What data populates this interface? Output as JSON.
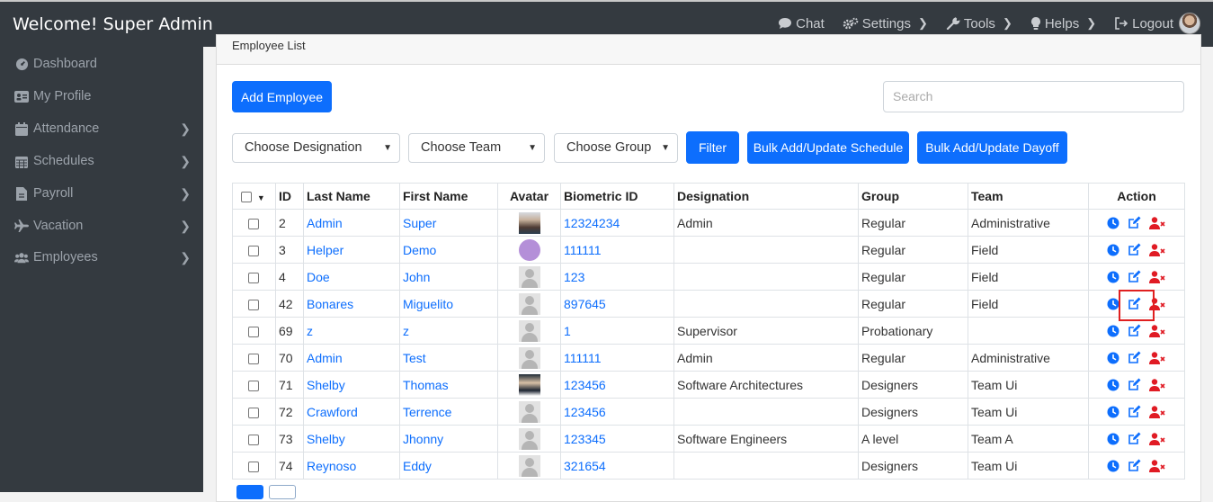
{
  "header": {
    "brand": "Welcome! Super Admin",
    "nav": [
      {
        "label": "Chat",
        "icon": "chat-icon"
      },
      {
        "label": "Settings",
        "icon": "gear-icon"
      },
      {
        "label": "Tools",
        "icon": "wrench-icon"
      },
      {
        "label": "Helps",
        "icon": "lightbulb-icon"
      },
      {
        "label": "Logout",
        "icon": "logout-icon"
      }
    ]
  },
  "sidebar": {
    "items": [
      {
        "label": "Dashboard",
        "icon": "dashboard-icon",
        "has_children": false
      },
      {
        "label": "My Profile",
        "icon": "id-card-icon",
        "has_children": false
      },
      {
        "label": "Attendance",
        "icon": "calendar-icon",
        "has_children": true
      },
      {
        "label": "Schedules",
        "icon": "calendar-grid-icon",
        "has_children": true
      },
      {
        "label": "Payroll",
        "icon": "file-icon",
        "has_children": true
      },
      {
        "label": "Vacation",
        "icon": "plane-icon",
        "has_children": true
      },
      {
        "label": "Employees",
        "icon": "users-icon",
        "has_children": true
      }
    ]
  },
  "card": {
    "title": "Employee List"
  },
  "toolbar": {
    "add_employee": "Add Employee",
    "search_placeholder": "Search",
    "designation_select": "Choose Designation",
    "team_select": "Choose Team",
    "group_select": "Choose Group",
    "filter": "Filter",
    "bulk_schedule": "Bulk Add/Update Schedule",
    "bulk_dayoff": "Bulk Add/Update Dayoff"
  },
  "table": {
    "headers": [
      "ID",
      "Last Name",
      "First Name",
      "Avatar",
      "Biometric ID",
      "Designation",
      "Group",
      "Team",
      "Action"
    ],
    "rows": [
      {
        "id": "2",
        "last": "Admin",
        "first": "Super",
        "avatar": "photo1",
        "bio": "12324234",
        "designation": "Admin",
        "group": "Regular",
        "team": "Administrative"
      },
      {
        "id": "3",
        "last": "Helper",
        "first": "Demo",
        "avatar": "photo2",
        "bio": "111111",
        "designation": "",
        "group": "Regular",
        "team": "Field"
      },
      {
        "id": "4",
        "last": "Doe",
        "first": "John",
        "avatar": "generic",
        "bio": "123",
        "designation": "",
        "group": "Regular",
        "team": "Field"
      },
      {
        "id": "42",
        "last": "Bonares",
        "first": "Miguelito",
        "avatar": "generic",
        "bio": "897645",
        "designation": "",
        "group": "Regular",
        "team": "Field"
      },
      {
        "id": "69",
        "last": "z",
        "first": "z",
        "avatar": "generic",
        "bio": "1",
        "designation": "Supervisor",
        "group": "Probationary",
        "team": ""
      },
      {
        "id": "70",
        "last": "Admin",
        "first": "Test",
        "avatar": "generic",
        "bio": "111111",
        "designation": "Admin",
        "group": "Regular",
        "team": "Administrative"
      },
      {
        "id": "71",
        "last": "Shelby",
        "first": "Thomas",
        "avatar": "photo3",
        "bio": "123456",
        "designation": "Software Architectures",
        "group": "Designers",
        "team": "Team Ui"
      },
      {
        "id": "72",
        "last": "Crawford",
        "first": "Terrence",
        "avatar": "generic",
        "bio": "123456",
        "designation": "",
        "group": "Designers",
        "team": "Team Ui"
      },
      {
        "id": "73",
        "last": "Shelby",
        "first": "Jhonny",
        "avatar": "generic",
        "bio": "123345",
        "designation": "Software Engineers",
        "group": "A level",
        "team": "Team A"
      },
      {
        "id": "74",
        "last": "Reynoso",
        "first": "Eddy",
        "avatar": "generic",
        "bio": "321654",
        "designation": "",
        "group": "Designers",
        "team": "Team Ui"
      }
    ]
  },
  "colors": {
    "primary": "#0d6efd",
    "danger": "#e01b24",
    "topbar": "#343a40"
  }
}
